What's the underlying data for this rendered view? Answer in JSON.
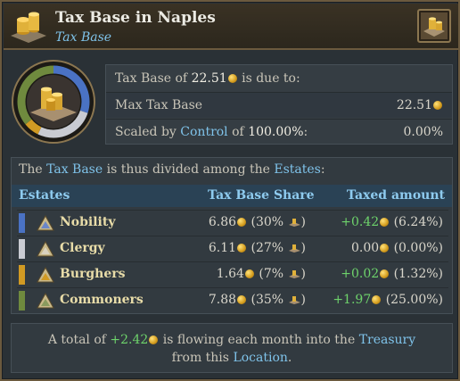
{
  "header": {
    "title": "Tax Base in Naples",
    "subtitle": "Tax Base"
  },
  "info": {
    "row1_pre": "Tax Base of",
    "row1_value": "22.51",
    "row1_post": "is due to:",
    "row2_label": "Max Tax Base",
    "row2_value": "22.51",
    "row3_pre": "Scaled by",
    "row3_link": "Control",
    "row3_mid": "of",
    "row3_pct": "100.00%",
    "row3_colon": ":",
    "row3_value": "0.00%"
  },
  "estates": {
    "intro_pre": "The",
    "intro_link1": "Tax Base",
    "intro_mid": "is thus divided among the",
    "intro_link2": "Estates",
    "intro_post": ":",
    "columns": [
      "Estates",
      "Tax Base Share",
      "Taxed amount"
    ],
    "rows": [
      {
        "name": "Nobility",
        "share": "6.86",
        "pct": "(30%",
        "taxed": "+0.42",
        "taxed_pct": "(6.24%)",
        "color": "#4a72c4",
        "taxed_color": "green"
      },
      {
        "name": "Clergy",
        "share": "6.11",
        "pct": "(27%",
        "taxed": "0.00",
        "taxed_pct": "(0.00%)",
        "color": "#c9cbd2",
        "taxed_color": "plain"
      },
      {
        "name": "Burghers",
        "share": "1.64",
        "pct": "(7%",
        "taxed": "+0.02",
        "taxed_pct": "(1.32%)",
        "color": "#d19a23",
        "taxed_color": "green"
      },
      {
        "name": "Commoners",
        "share": "7.88",
        "pct": "(35%",
        "taxed": "+1.97",
        "taxed_pct": "(25.00%)",
        "color": "#6f8a3e",
        "taxed_color": "green"
      }
    ]
  },
  "footer": {
    "pre": "A total of",
    "amount": "+2.42",
    "mid": "is flowing each month into the",
    "link1": "Treasury",
    "line2_pre": "from this",
    "link2": "Location",
    "post": "."
  },
  "colors": {
    "accent_blue": "#7fc3ea",
    "positive_green": "#6ed36b",
    "border_gold": "#6b5a3e"
  }
}
